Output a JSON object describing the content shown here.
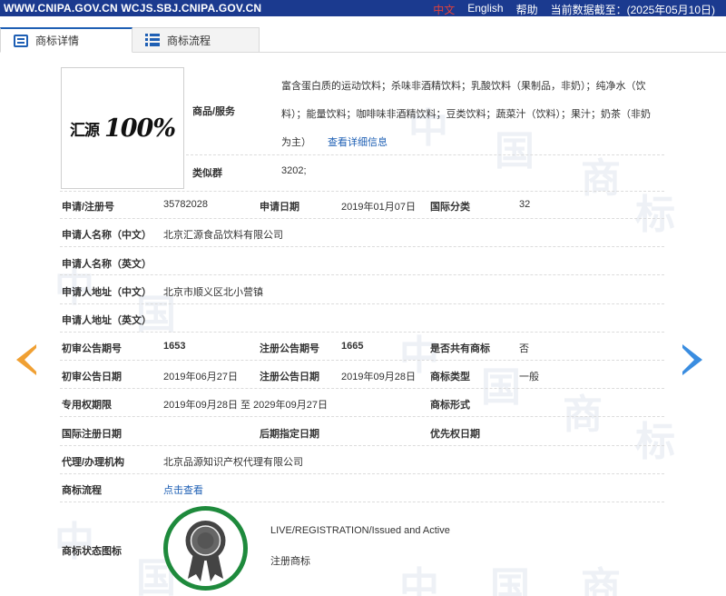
{
  "topbar": {
    "site": "WWW.CNIPA.GOV.CN WCJS.SBJ.CNIPA.GOV.CN",
    "lang_cn": "中文",
    "lang_en": "English",
    "help": "帮助",
    "data_date": "当前数据截至：(2025年05月10日)"
  },
  "tabs": {
    "detail": "商标详情",
    "flow": "商标流程"
  },
  "trademark": {
    "logo_cn": "汇源",
    "logo_num": "100%",
    "goods_label": "商品/服务",
    "goods_text": "富含蛋白质的运动饮料；杀味非酒精饮料；乳酸饮料（果制品，非奶）；纯净水（饮料）；能量饮料；咖啡味非酒精饮料；豆类饮料；蔬菜汁（饮料）；果汁；奶茶（非奶为主）",
    "goods_more": "查看详细信息",
    "similar_group_label": "类似群",
    "similar_group": "3202;",
    "reg_no_label": "申请/注册号",
    "reg_no": "35782028",
    "apply_date_label": "申请日期",
    "apply_date": "2019年01月07日",
    "intl_class_label": "国际分类",
    "intl_class": "32",
    "applicant_cn_label": "申请人名称（中文）",
    "applicant_cn": "北京汇源食品饮料有限公司",
    "applicant_en_label": "申请人名称（英文）",
    "address_cn_label": "申请人地址（中文）",
    "address_cn": "北京市顺义区北小营镇",
    "address_en_label": "申请人地址（英文）",
    "first_pub_no_label": "初审公告期号",
    "first_pub_no": "1653",
    "reg_pub_no_label": "注册公告期号",
    "reg_pub_no": "1665",
    "shared_label": "是否共有商标",
    "shared": "否",
    "first_pub_date_label": "初审公告日期",
    "first_pub_date": "2019年06月27日",
    "reg_pub_date_label": "注册公告日期",
    "reg_pub_date": "2019年09月28日",
    "tm_type_label": "商标类型",
    "tm_type": "一般",
    "exclusive_label": "专用权期限",
    "exclusive": "2019年09月28日 至 2029年09月27日",
    "tm_form_label": "商标形式",
    "intl_reg_date_label": "国际注册日期",
    "later_designation_label": "后期指定日期",
    "priority_date_label": "优先权日期",
    "agent_label": "代理/办理机构",
    "agent": "北京品源知识产权代理有限公司",
    "process_label": "商标流程",
    "process_link": "点击查看",
    "status_icon_label": "商标状态图标",
    "status_en": "LIVE/REGISTRATION/Issued and Active",
    "status_cn": "注册商标"
  },
  "colors": {
    "topbar": "#1b3a8f",
    "link": "#1e5fb4",
    "arrow_prev": "#f0a033",
    "arrow_next": "#3a8de0",
    "badge_ring": "#1e8a3c"
  },
  "icons": {
    "prev": "arrow-left-icon",
    "next": "arrow-right-icon",
    "status": "registered-badge-icon"
  }
}
